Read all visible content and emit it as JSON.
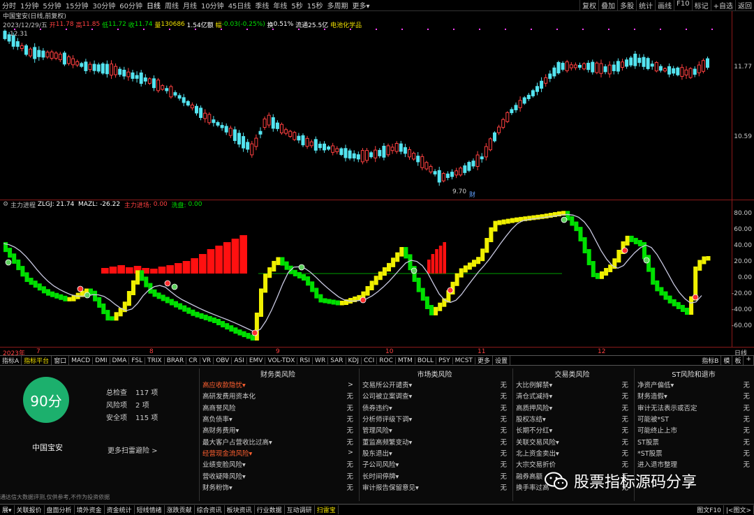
{
  "topbar": {
    "periods": [
      "分时",
      "1分钟",
      "5分钟",
      "15分钟",
      "30分钟",
      "60分钟",
      "日线",
      "周线",
      "月线",
      "10分钟",
      "45日线",
      "季线",
      "年线",
      "5秒",
      "15秒",
      "多周期",
      "更多▾"
    ],
    "active": "日线",
    "right": [
      "复权",
      "叠加",
      "多股",
      "统计",
      "画线",
      "F10",
      "标记",
      "+自选",
      "返回"
    ]
  },
  "stock_line": "中国宝安(日线,前复权)",
  "info": {
    "date": "2023/12/29/五",
    "open_label": "开",
    "open": "11.78",
    "high_label": "高",
    "high": "11.85",
    "low_label": "低",
    "low": "11.72",
    "close_label": "收",
    "close": "11.74",
    "vol_label": "量",
    "vol": "130686",
    "amt_label": "额",
    "amt": "1.54亿",
    "chg_label": "幅",
    "chg": "-0.03(-0.25%)",
    "turn_label": "换",
    "turn": "0.51%",
    "float_label": "流通",
    "float": "25.5亿",
    "sector": "电池化学品"
  },
  "price_axis": [
    "11.77",
    "10.59"
  ],
  "marks": {
    "high_label": "12.31",
    "low_label": "9.70",
    "cai": "财"
  },
  "indicator": {
    "name": "主力进程",
    "zlgj_label": "ZLGJ:",
    "zlgj": "21.74",
    "mazl_label": "MAZL:",
    "mazl": "-26.22",
    "zljc_label": "主力进场:",
    "zljc": "0.00",
    "xp_label": "洗盘:",
    "xp": "0.00"
  },
  "ind_axis": [
    "80.00",
    "60.00",
    "40.00",
    "20.00",
    "0.00",
    "-20.00",
    "-40.00",
    "-60.00"
  ],
  "date_axis": {
    "labels": [
      "2023年",
      "7",
      "8",
      "9",
      "10",
      "11",
      "12"
    ],
    "right": "日线"
  },
  "tabs": {
    "items": [
      "指标A",
      "指标平台",
      "窗口",
      "MACD",
      "DMI",
      "DMA",
      "FSL",
      "TRIX",
      "BRAR",
      "CR",
      "VR",
      "OBV",
      "ASI",
      "EMV",
      "VOL-TDX",
      "RSI",
      "WR",
      "SAR",
      "KDJ",
      "CCI",
      "ROC",
      "MTM",
      "BOLL",
      "PSY",
      "MCST",
      "更多",
      "设置"
    ],
    "active": "指标平台",
    "right": [
      "指标B",
      "模",
      "板",
      "+"
    ]
  },
  "risk": {
    "score": "90分",
    "name": "中国宝安",
    "total_label": "总检查",
    "total": "117",
    "total_unit": "项",
    "risk_label": "风险项",
    "risk_count": "2",
    "risk_unit": "项",
    "safe_label": "安全项",
    "safe_count": "115",
    "safe_unit": "项",
    "more": "更多扫雷避险 >",
    "disclaimer": "通达信大数据评测,仅供参考,不作为投资依据"
  },
  "columns": [
    {
      "title": "财务类风险",
      "rows": [
        {
          "name": "高应收款隐忧▾",
          "result": ">",
          "hl": true
        },
        {
          "name": "高研发费用资本化",
          "result": "无"
        },
        {
          "name": "高商誉风险",
          "result": "无"
        },
        {
          "name": "高负债率▾",
          "result": "无"
        },
        {
          "name": "高财务费用▾",
          "result": "无"
        },
        {
          "name": "最大客户占营收比过高▾",
          "result": "无"
        },
        {
          "name": "经营现金流风险▾",
          "result": ">",
          "hl": true
        },
        {
          "name": "业绩变脸风险▾",
          "result": "无"
        },
        {
          "name": "营收疑降风险▾",
          "result": "无"
        },
        {
          "name": "财务粉饰▾",
          "result": "无"
        }
      ]
    },
    {
      "title": "市场类风险",
      "rows": [
        {
          "name": "交易所公开谴责▾",
          "result": "无"
        },
        {
          "name": "公司被立案调查▾",
          "result": "无"
        },
        {
          "name": "债券违约▾",
          "result": "无"
        },
        {
          "name": "分析师评级下调▾",
          "result": "无"
        },
        {
          "name": "管理风险▾",
          "result": "无"
        },
        {
          "name": "董监高频繁变动▾",
          "result": "无"
        },
        {
          "name": "股东退出▾",
          "result": "无"
        },
        {
          "name": "子公司风险▾",
          "result": "无"
        },
        {
          "name": "长时间停牌▾",
          "result": "无"
        },
        {
          "name": "审计报告保留意见▾",
          "result": "无"
        }
      ]
    },
    {
      "title": "交易类风险",
      "rows": [
        {
          "name": "大比例解禁▾",
          "result": "无"
        },
        {
          "name": "清仓式减持▾",
          "result": "无"
        },
        {
          "name": "高质押风险▾",
          "result": "无"
        },
        {
          "name": "股权冻结▾",
          "result": "无"
        },
        {
          "name": "长期不分红▾",
          "result": "无"
        },
        {
          "name": "关联交易风险▾",
          "result": "无"
        },
        {
          "name": "北上资金卖出▾",
          "result": "无"
        },
        {
          "name": "大宗交易折价",
          "result": "无"
        },
        {
          "name": "融券高额",
          "result": "无"
        },
        {
          "name": "换手率过高",
          "result": "无"
        }
      ]
    },
    {
      "title": "ST风险和退市",
      "rows": [
        {
          "name": "净资产偏低▾",
          "result": "无"
        },
        {
          "name": "财务造假▾",
          "result": "无"
        },
        {
          "name": "审计无法表示或否定",
          "result": "无"
        },
        {
          "name": "可能被*ST",
          "result": "无"
        },
        {
          "name": "可能终止上市",
          "result": "无"
        },
        {
          "name": "ST股票",
          "result": "无"
        },
        {
          "name": "*ST股票",
          "result": "无"
        },
        {
          "name": "进入退市整理",
          "result": "无"
        },
        {
          "name": "",
          "result": ""
        },
        {
          "name": "",
          "result": ""
        }
      ]
    }
  ],
  "watermark": "股票指标源码分享",
  "bottombar": {
    "items": [
      "展▾",
      "关联报价",
      "盘面分析",
      "境外资金",
      "资金统计",
      "短线情绪",
      "涨跌贡献",
      "综合资讯",
      "板块资讯",
      "行业数据",
      "互动调研",
      "扫雷宝"
    ],
    "active": "扫雷宝",
    "right": [
      "图文F10",
      "|<图文>"
    ]
  },
  "colors": {
    "up": "#ff4040",
    "down": "#54e4f0",
    "ind_up": "#f0f000",
    "ind_down": "#00e000",
    "mazl": "#c8c8e0",
    "bar": "#ff1010",
    "border": "#8b1a1a"
  }
}
